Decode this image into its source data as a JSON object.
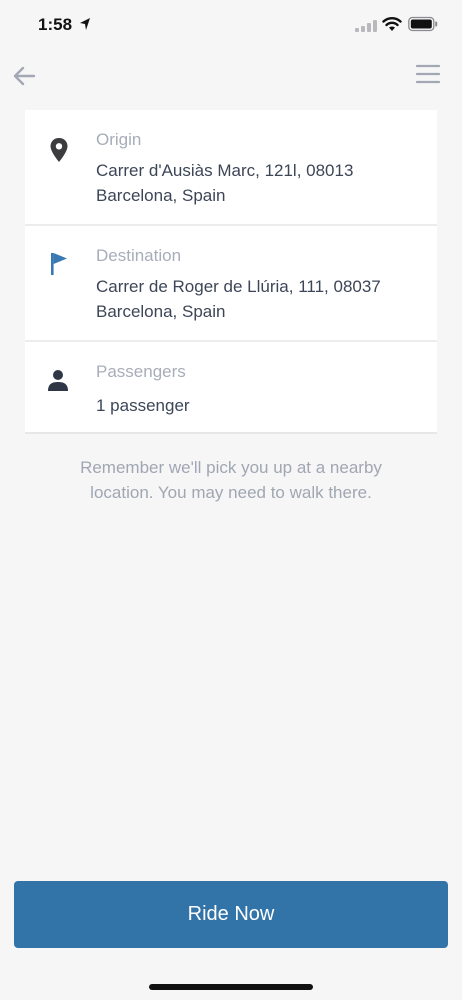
{
  "status_bar": {
    "time": "1:58"
  },
  "nav": {
    "back_icon": "arrow-left-icon",
    "menu_icon": "hamburger-menu-icon"
  },
  "trip": {
    "origin": {
      "label": "Origin",
      "value": "Carrer d'Ausiàs Marc, 121l, 08013 Barcelona, Spain",
      "icon": "map-pin-icon"
    },
    "destination": {
      "label": "Destination",
      "value": "Carrer de Roger de Llúria, 111, 08037 Barcelona, Spain",
      "icon": "flag-icon"
    },
    "passengers": {
      "label": "Passengers",
      "value": "1 passenger",
      "icon": "person-icon"
    }
  },
  "notice": "Remember we'll pick you up at a nearby location. You may need to walk there.",
  "ride_button": {
    "label": "Ride Now"
  },
  "colors": {
    "accent": "#3273a8",
    "flag": "#3a78b4",
    "background": "#f6f6f7",
    "label": "#a7adb9",
    "text": "#3d4657"
  }
}
